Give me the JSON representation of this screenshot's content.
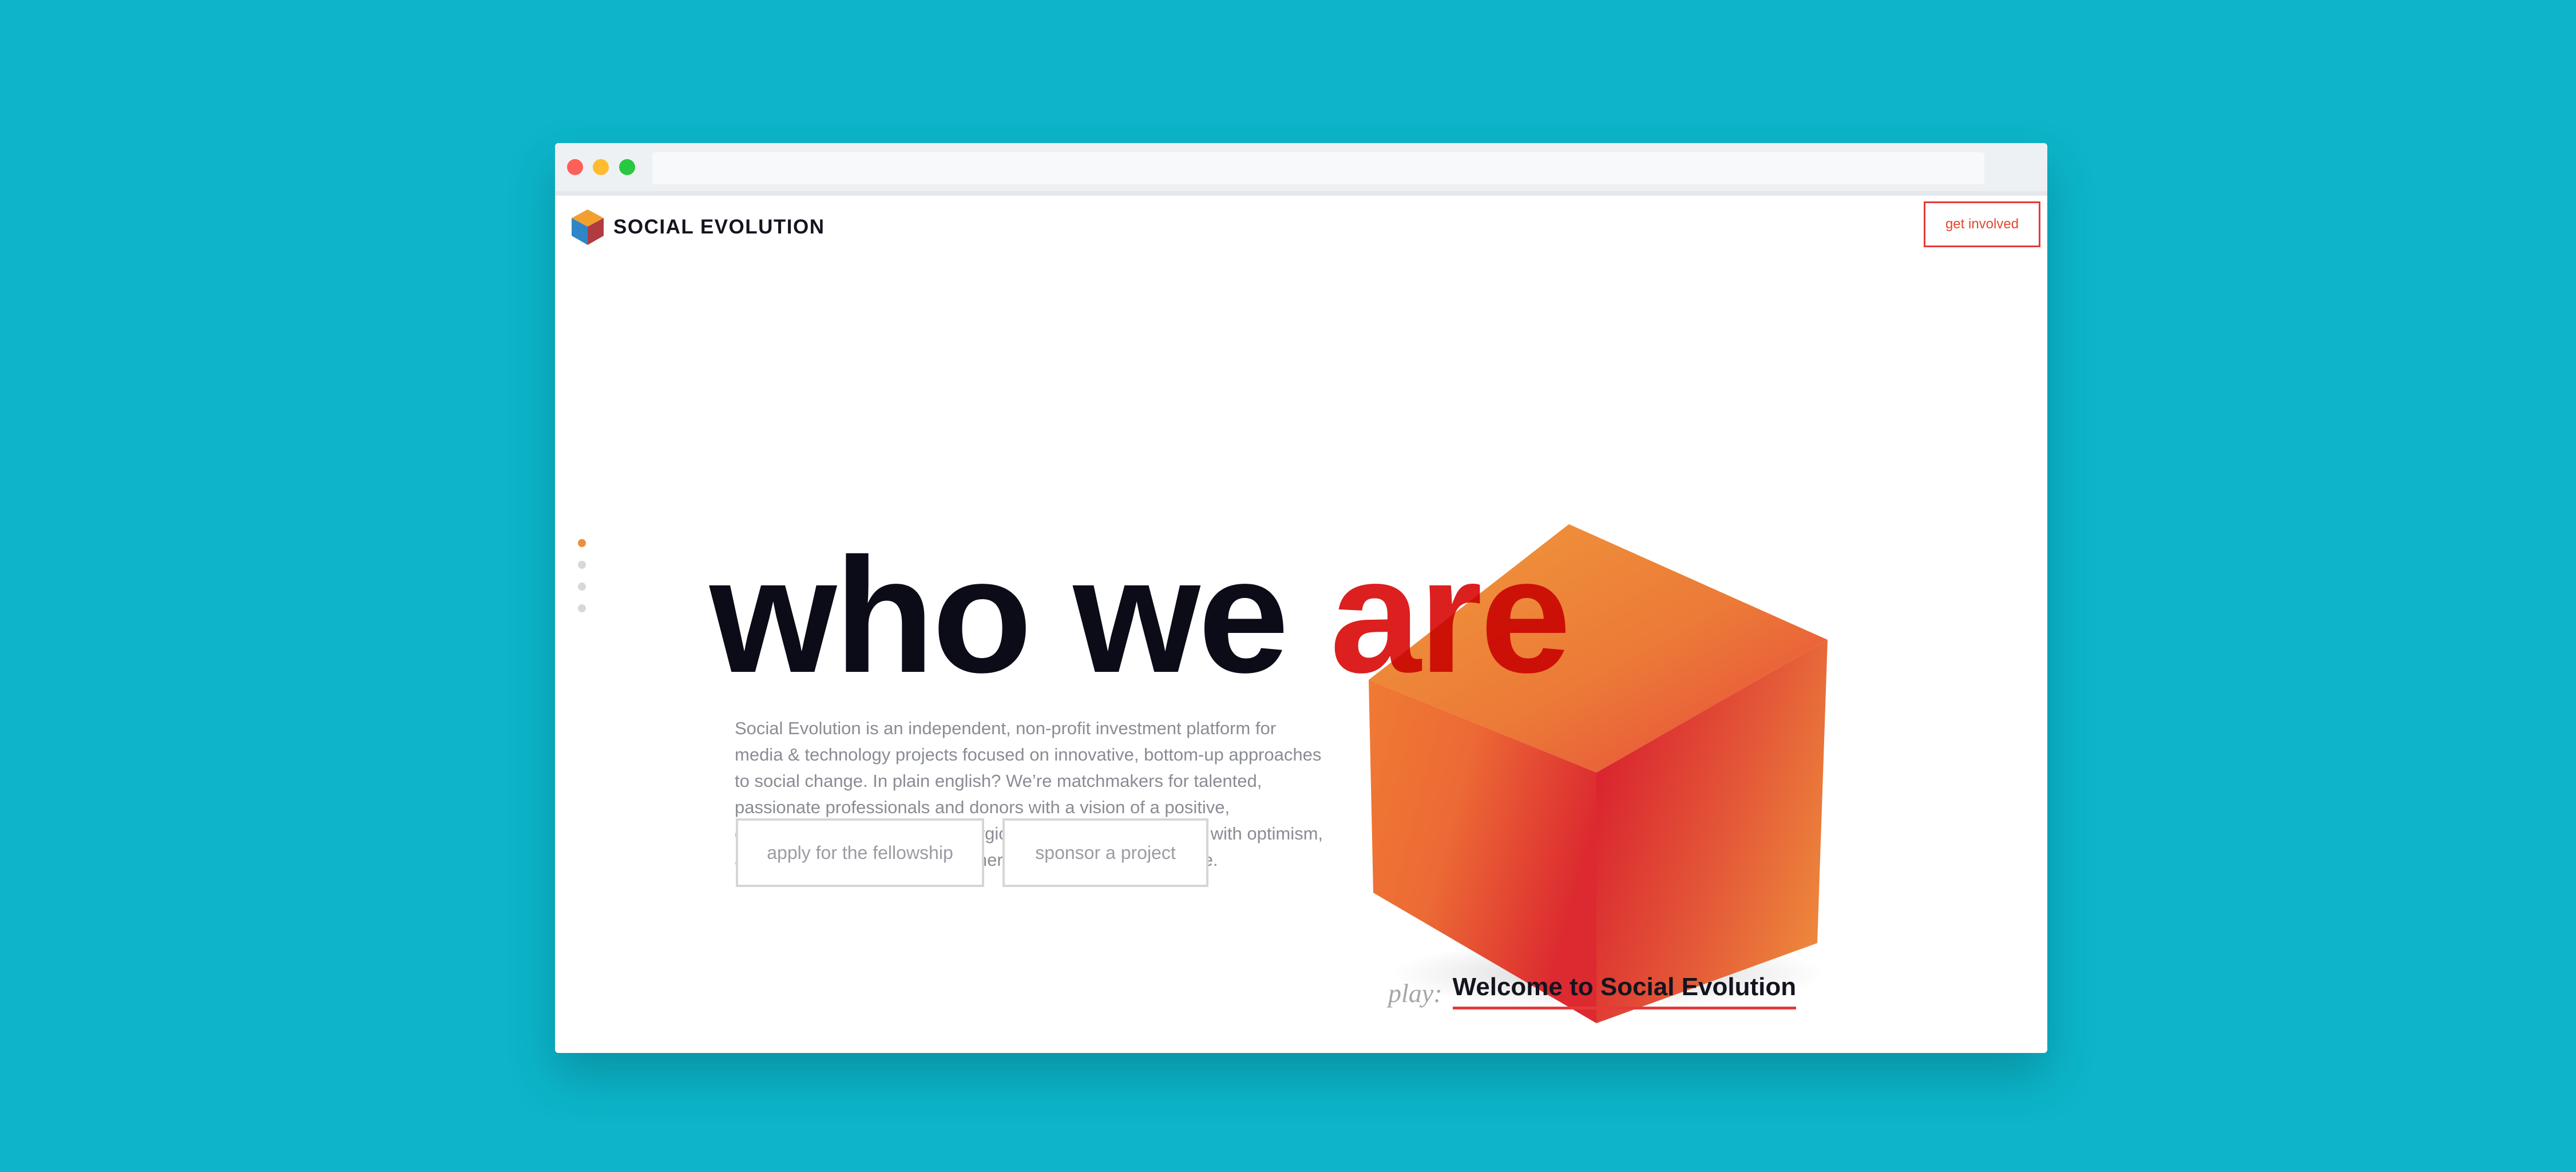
{
  "brand": {
    "name": "SOCIAL EVOLUTION",
    "logo_icon": "cube-logo-icon"
  },
  "header": {
    "cta_label": "get involved"
  },
  "hero": {
    "headline_part1": "who we ",
    "headline_part2": "are",
    "description": "Social Evolution is an independent, non-profit investment platform for media & technology projects focused on innovative, bottom-up approaches to social change. In plain english? We’re matchmakers for talented, passionate professionals and donors with a vision of a positive, decentralized future. We’re allergic to politics, we’re infected with optimism, and we don’t wait around for other people to invent the future.",
    "buttons": [
      {
        "label": "apply for the fellowship"
      },
      {
        "label": "sponsor a project"
      }
    ]
  },
  "slide_nav": {
    "count": 4,
    "active_index": 0
  },
  "video": {
    "prefix": "play:",
    "title": "Welcome to Social Evolution"
  },
  "colors": {
    "background": "#0cb5ca",
    "accent_red": "#e5393a",
    "accent_orange": "#ef8e3a",
    "text_dark": "#0b0c17"
  }
}
